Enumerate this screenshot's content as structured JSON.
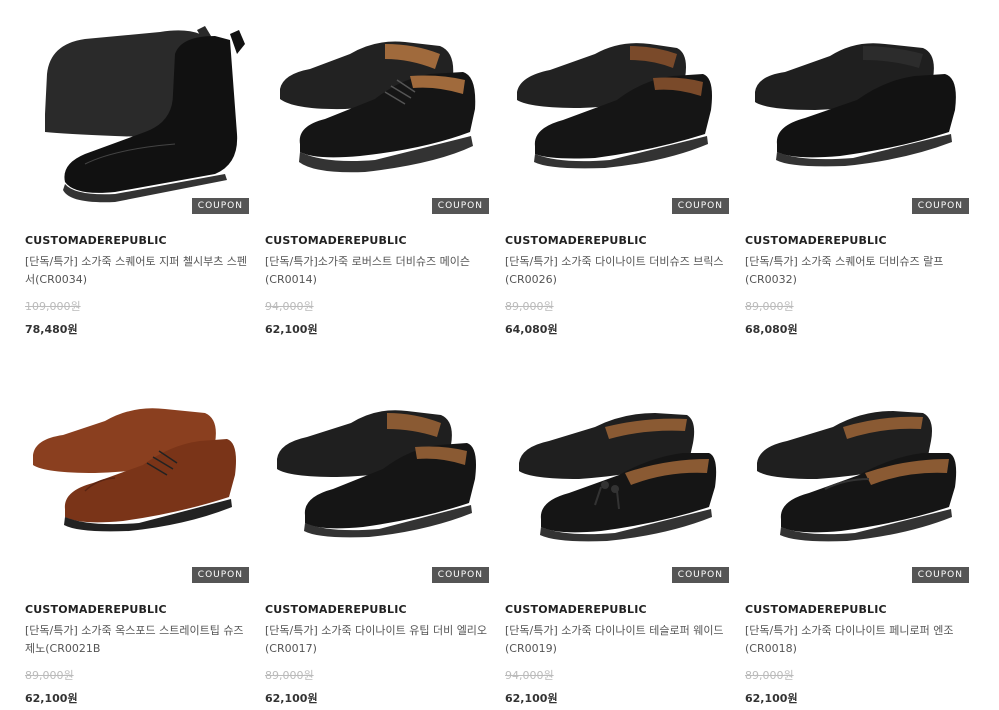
{
  "products": [
    {
      "brand": "CUSTOMADEREPUBLIC",
      "name": "[단독/특가] 소가죽 스퀘어토 지퍼 첼시부츠 스펜서(CR0034)",
      "original_price": "109,000원",
      "price": "78,480원",
      "coupon": "COUPON",
      "color": "#1a1a1a",
      "style": "boot"
    },
    {
      "brand": "CUSTOMADEREPUBLIC",
      "name": "[단독/특가]소가죽 로버스트 더비슈즈 메이슨(CR0014)",
      "original_price": "94,000원",
      "price": "62,100원",
      "coupon": "COUPON",
      "color": "#1a1a1a",
      "style": "derby"
    },
    {
      "brand": "CUSTOMADEREPUBLIC",
      "name": "[단독/특가] 소가죽 다이나이트 더비슈즈 브릭스(CR0026)",
      "original_price": "89,000원",
      "price": "64,080원",
      "coupon": "COUPON",
      "color": "#1a1a1a",
      "style": "derby"
    },
    {
      "brand": "CUSTOMADEREPUBLIC",
      "name": "[단독/특가] 소가죽 스퀘어토 더비슈즈 랄프(CR0032)",
      "original_price": "89,000원",
      "price": "68,080원",
      "coupon": "COUPON",
      "color": "#1a1a1a",
      "style": "derby"
    },
    {
      "brand": "CUSTOMADEREPUBLIC",
      "name": "[단독/특가] 소가죽 옥스포드 스트레이트팁 슈즈 제노(CR0021B",
      "original_price": "89,000원",
      "price": "62,100원",
      "coupon": "COUPON",
      "color": "#8a3f1f",
      "style": "oxford"
    },
    {
      "brand": "CUSTOMADEREPUBLIC",
      "name": "[단독/특가] 소가죽 다이나이트 유팁 더비 엘리오(CR0017)",
      "original_price": "89,000원",
      "price": "62,100원",
      "coupon": "COUPON",
      "color": "#1a1a1a",
      "style": "derby"
    },
    {
      "brand": "CUSTOMADEREPUBLIC",
      "name": "[단독/특가] 소가죽 다이나이트 테슬로퍼 웨이드(CR0019)",
      "original_price": "94,000원",
      "price": "62,100원",
      "coupon": "COUPON",
      "color": "#1a1a1a",
      "style": "loafer"
    },
    {
      "brand": "CUSTOMADEREPUBLIC",
      "name": "[단독/특가] 소가죽 다이나이트 페니로퍼 엔조(CR0018)",
      "original_price": "89,000원",
      "price": "62,100원",
      "coupon": "COUPON",
      "color": "#1a1a1a",
      "style": "loafer"
    }
  ]
}
